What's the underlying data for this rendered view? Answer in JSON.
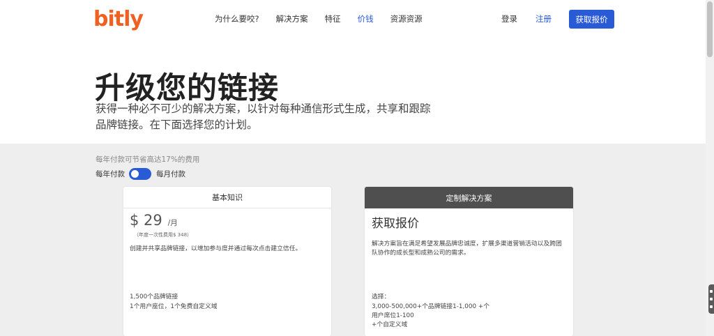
{
  "brand": {
    "logo": "bitly",
    "logo_color": "#ee6123",
    "accent": "#2a5bd7"
  },
  "nav": {
    "items": [
      {
        "label": "为什么要咬?"
      },
      {
        "label": "解决方案"
      },
      {
        "label": "特征"
      },
      {
        "label": "价钱",
        "active": true
      },
      {
        "label": "资源资源"
      }
    ],
    "login": "登录",
    "signup": "注册",
    "quote_button": "获取报价"
  },
  "hero": {
    "title": "升级您的链接",
    "subtitle": "获得一种必不可少的解决方案，以针对每种通信形式生成，共享和跟踪品牌链接。在下面选择您的计划。"
  },
  "billing": {
    "save_note": "每年付款可节省高达17%的费用",
    "annual_label": "每年付款",
    "monthly_label": "每月付款"
  },
  "plans": {
    "basic": {
      "name": "基本知识",
      "price": "$ 29",
      "unit": "/月",
      "annual": "（年度一次性费用$ 348）",
      "description": "创建并共享品牌链接，以增加参与度并通过每次点击建立信任。",
      "features": [
        "1,500个品牌链接",
        "1个用户座位，1个免费自定义域"
      ]
    },
    "custom": {
      "name": "定制解决方案",
      "title": "获取报价",
      "description": "解决方案旨在满足希望发展品牌忠诚度，扩展多渠道营销活动以及跨团队协作的成长型和成熟公司的需求。",
      "features": [
        "选择：",
        "3,000-500,000+个品牌链接1-1,000 +个",
        "用户席位1-100",
        "+个自定义域"
      ]
    }
  }
}
